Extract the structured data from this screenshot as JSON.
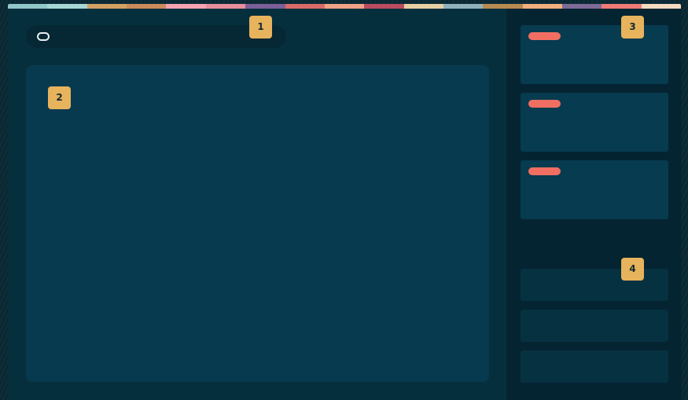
{
  "annotations": {
    "badge_1": "1",
    "badge_2": "2",
    "badge_3": "3",
    "badge_4": "4"
  },
  "top_strip_colors": [
    "#91c7c6",
    "#a6d7d4",
    "#d3a064",
    "#c98a5c",
    "#f5a3b1",
    "#e68e9c",
    "#7a5f98",
    "#d86b69",
    "#efa286",
    "#b94c5f",
    "#e7cfa3",
    "#90b2bc",
    "#b78a51",
    "#f0b17f",
    "#7d6a96",
    "#f07b76",
    "#f4dac0"
  ],
  "colors": {
    "app_bg": "#062f3d",
    "side_bg": "#052431",
    "content_bg": "#073a4f",
    "card_bg": "#073b4f",
    "tag": "#f06e62",
    "badge": "#e7b35c"
  }
}
